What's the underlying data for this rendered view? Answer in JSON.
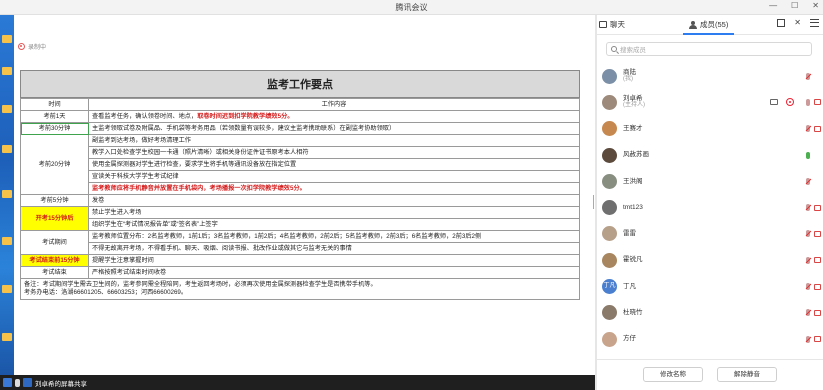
{
  "window": {
    "title": "腾讯会议"
  },
  "share": {
    "recording_label": "录制中",
    "status_label": "刘卓希的屏幕共享"
  },
  "doc": {
    "title": "监考工作要点",
    "col_time": "时间",
    "col_content": "工作内容",
    "rows": {
      "r1_time": "考前1天",
      "r1_a": "查看监考任务，确认领卷时间、地点，",
      "r1_b": "取卷时间迟到扣学院教学绩效5分。",
      "r2_time": "考前30分钟",
      "r2_a": "主监考领取试卷及附属品、手机袋等考务用品（若领数量有误较多，建议主监考携助联系）在副监考协助领取）",
      "r3_time": "考前20分钟",
      "r3_a": "副监考到达考场，做好考场清理工作",
      "r3_b": "教学入口处检查学生校园一卡通（照片清晰）或相关身份证件证书原考本人相符",
      "r3_c": "使用金属探测器对学生进行检查，要求学生将手机等通讯设备放在指定位置",
      "r3_d": "宣读关于科技大学学生考试纪律",
      "r3_e": "监考教师应将手机静音并放置在手机袋内，考场播报一次扣学院教学绩效5分。",
      "r4_time": "考前5分钟",
      "r4_a": "发卷",
      "r5_time": "开考15分钟后",
      "r5_a": "禁止学生进入考场",
      "r5_b": "组织学生在“考试情况报告单”或“签名表”上签字",
      "r6_time": "考试期间",
      "r6_a": "监考教师位置分布：2名监考教师，1前1后；3名监考教师，1前2后；4名监考教师，2前2后；5名监考教师，2前3后；6名监考教师，2前3后2侧",
      "r6_b": "不得无故离开考场，不得看手机、聊天、吸烟、阅读书报、批改作业或做其它与监考无关的事情",
      "r7_time": "考试结束前15分钟",
      "r7_a": "提醒学生注意掌握时间",
      "r8_time": "考试结束",
      "r8_a": "严格按照考试结束时间收卷"
    },
    "note1": "备注：考试期间学生需去卫生间的，监考参同需全程陪同，考生返回考场时，必须再次使用金属探测器检查学生是否携带手机等。",
    "note2": "考务办电话：洛湖66601205、66603253；河西66600269。"
  },
  "panel": {
    "tab_chat": "聊天",
    "tab_members": "成员(55)",
    "search_placeholder": "搜索成员",
    "members": [
      {
        "name": "商陆",
        "sub": "(我)",
        "avatar_color": "#7b8fa6"
      },
      {
        "name": "刘卓希",
        "sub": "(主持人)",
        "avatar_color": "#9d8a7a"
      },
      {
        "name": "王赛才",
        "sub": "",
        "avatar_color": "#c7884f"
      },
      {
        "name": "风赦苏画",
        "sub": "",
        "avatar_color": "#5c4a3d"
      },
      {
        "name": "王洪阁",
        "sub": "",
        "avatar_color": "#888f80"
      },
      {
        "name": "tmt123",
        "sub": "",
        "avatar_color": "#6f6f6f"
      },
      {
        "name": "雷雷",
        "sub": "",
        "avatar_color": "#b7a08a"
      },
      {
        "name": "霍锐凡",
        "sub": "",
        "avatar_color": "#a8865f"
      },
      {
        "name": "丁凡",
        "sub": "",
        "avatar_initials": "丁凡",
        "avatar_color": "#4a7fd0"
      },
      {
        "name": "杜晓竹",
        "sub": "",
        "avatar_color": "#8a7a6a"
      },
      {
        "name": "方仔",
        "sub": "",
        "avatar_color": "#c9a48c"
      }
    ],
    "btn_rename": "修改名称",
    "btn_unmute_all": "解除静音"
  }
}
